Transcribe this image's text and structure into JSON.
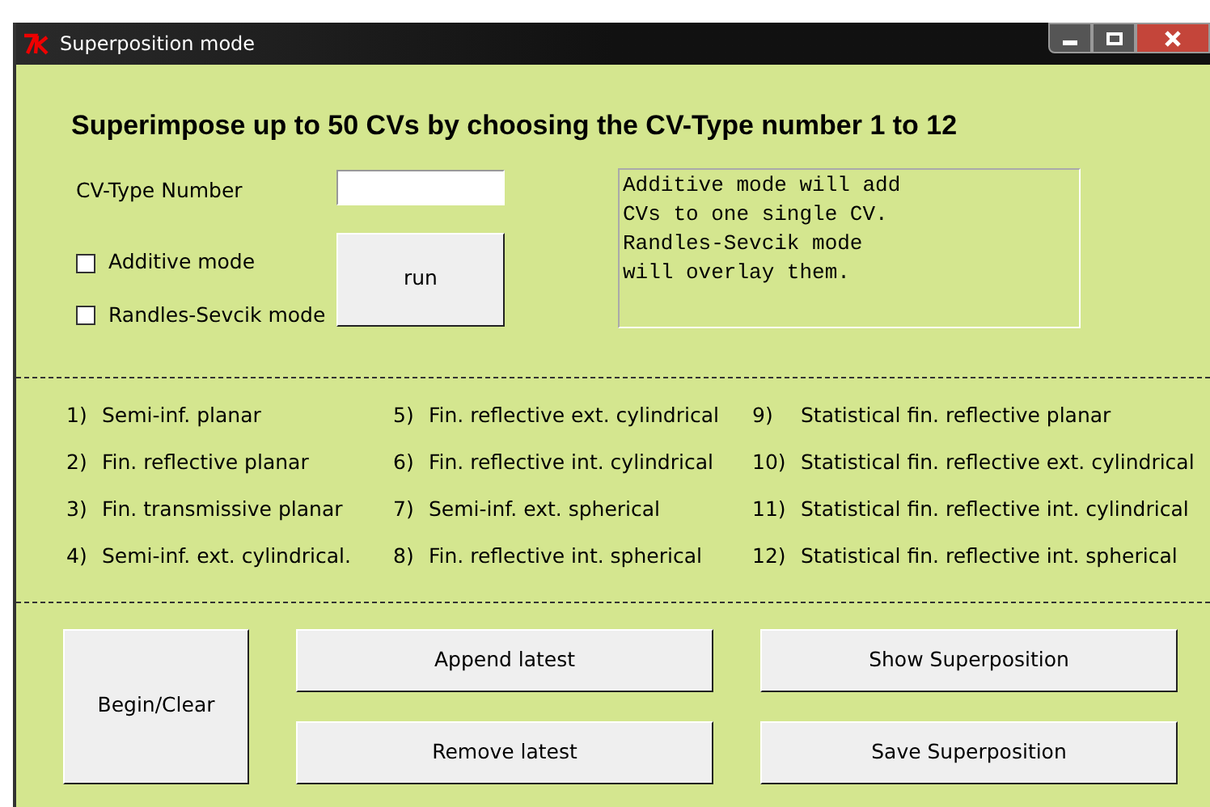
{
  "window": {
    "title": "Superposition mode"
  },
  "heading": "Superimpose up to 50 CVs by choosing the CV-Type number 1 to 12",
  "cv_type": {
    "label": "CV-Type Number"
  },
  "checkboxes": [
    {
      "label": "Additive mode",
      "checked": false
    },
    {
      "label": "Randles-Sevcik mode",
      "checked": false
    }
  ],
  "run_button": "run",
  "info_text": "Additive mode will add\nCVs to one single CV.\nRandles-Sevcik mode\nwill overlay them.",
  "types": [
    [
      {
        "number": "1)",
        "name": "Semi-inf. planar"
      },
      {
        "number": "2)",
        "name": "Fin. reflective planar"
      },
      {
        "number": "3)",
        "name": "Fin. transmissive planar"
      },
      {
        "number": "4)",
        "name": "Semi-inf. ext. cylindrical."
      }
    ],
    [
      {
        "number": "5)",
        "name": "Fin. reflective ext. cylindrical"
      },
      {
        "number": "6)",
        "name": "Fin. reflective int. cylindrical"
      },
      {
        "number": "7)",
        "name": "Semi-inf. ext. spherical"
      },
      {
        "number": "8)",
        "name": "Fin. reflective int. spherical"
      }
    ],
    [
      {
        "number": "9)",
        "name": "Statistical fin. reflective planar"
      },
      {
        "number": "10)",
        "name": "Statistical fin. reflective ext. cylindrical"
      },
      {
        "number": "11)",
        "name": "Statistical fin. reflective int. cylindrical"
      },
      {
        "number": "12)",
        "name": "Statistical fin. reflective int. spherical"
      }
    ]
  ],
  "buttons": {
    "begin": "Begin/Clear",
    "middle": [
      "Append latest",
      "Remove latest"
    ],
    "right": [
      "Show Superposition",
      "Save Superposition"
    ]
  }
}
